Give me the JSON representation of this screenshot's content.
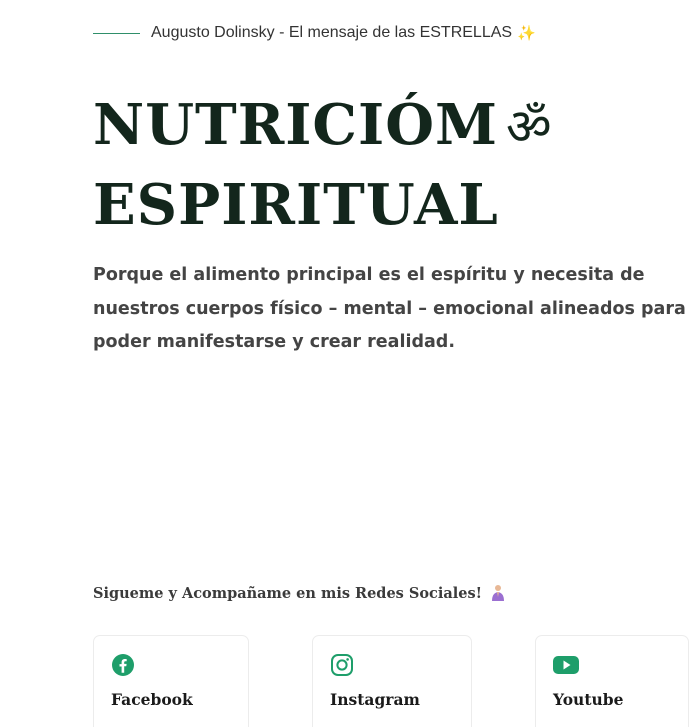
{
  "tagline": {
    "text": "Augusto Dolinsky - El mensaje de las ESTRELLAS",
    "sparkle": "✨"
  },
  "hero": {
    "title_line1": "NUTRICIÓM",
    "title_symbol": "ॐ",
    "title_line2": "ESPIRITUAL",
    "description": "Porque el alimento principal es el espíritu y necesita de nuestros cuerpos físico – mental – emocional alineados para poder manifestarse y crear realidad."
  },
  "social": {
    "heading": "Sigueme y Acompañame en mis Redes Sociales!",
    "heading_icon": "praying-hands-icon",
    "links": [
      {
        "label": "Facebook",
        "icon": "facebook-icon"
      },
      {
        "label": "Instagram",
        "icon": "instagram-icon"
      },
      {
        "label": "Youtube",
        "icon": "youtube-icon"
      }
    ]
  },
  "colors": {
    "accent": "#2f8f6a",
    "icon_green": "#1e9e6a",
    "title": "#13261c",
    "body_text": "#444444"
  }
}
